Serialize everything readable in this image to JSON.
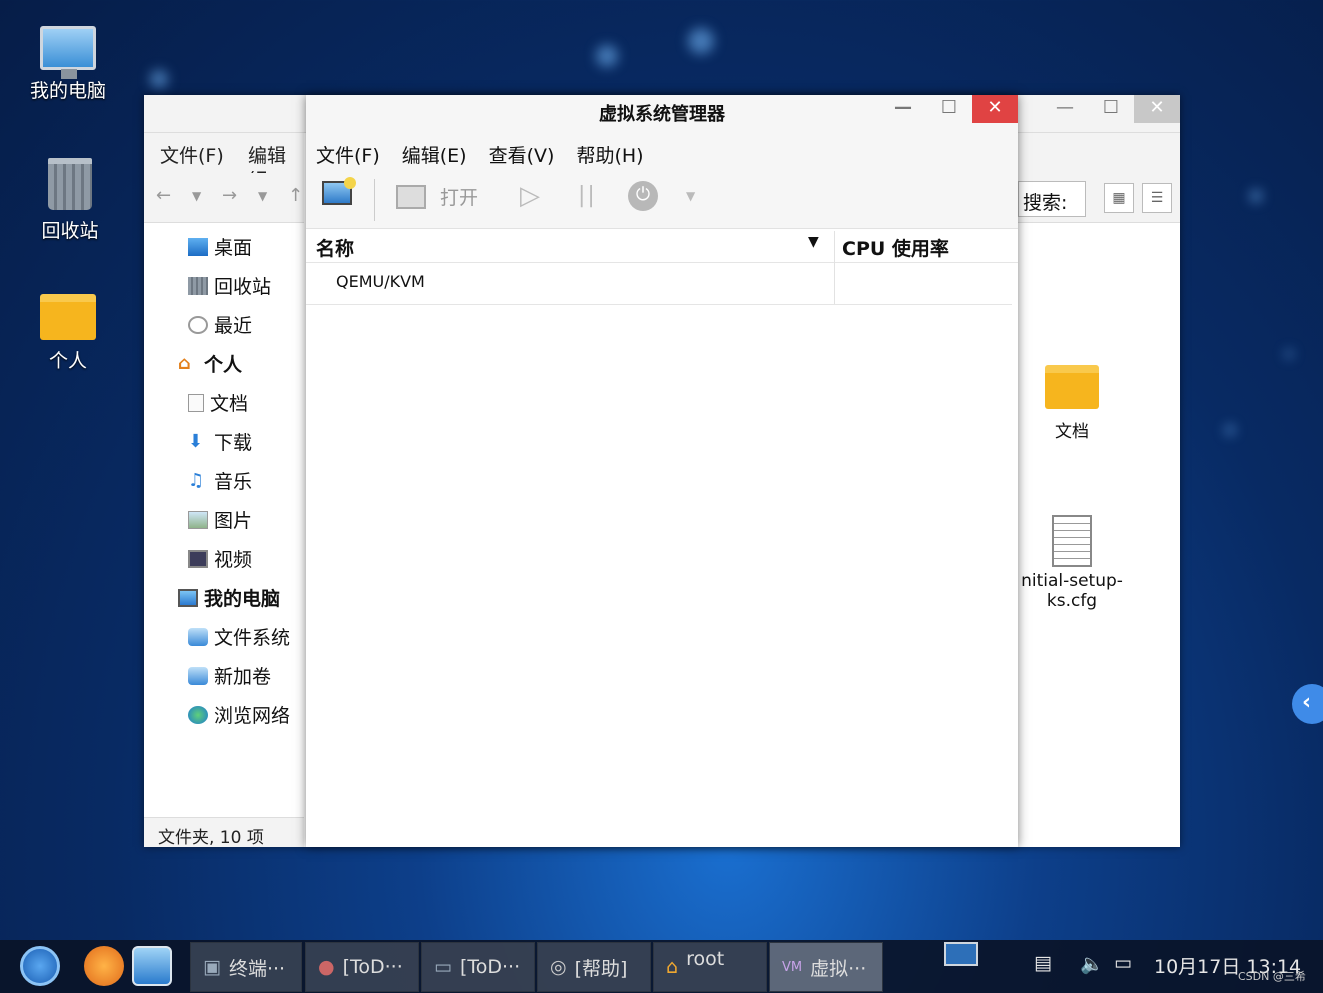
{
  "desktop": {
    "icons": [
      {
        "label": "我的电脑"
      },
      {
        "label": "回收站"
      },
      {
        "label": "个人"
      }
    ]
  },
  "file_manager": {
    "menu": {
      "file": "文件(F)",
      "edit": "编辑(E"
    },
    "sidebar": [
      {
        "label": "桌面"
      },
      {
        "label": "回收站"
      },
      {
        "label": "最近"
      },
      {
        "label": "个人"
      },
      {
        "label": "文档"
      },
      {
        "label": "下载"
      },
      {
        "label": "音乐"
      },
      {
        "label": "图片"
      },
      {
        "label": "视频"
      },
      {
        "label": "我的电脑"
      },
      {
        "label": "文件系统"
      },
      {
        "label": "新加卷"
      },
      {
        "label": "浏览网络"
      }
    ],
    "status": "文件夹, 10 项",
    "search_label": "搜索:",
    "files": [
      {
        "name": "文档"
      },
      {
        "name": "nitial-setup-ks.cfg"
      }
    ]
  },
  "vm_manager": {
    "title": "虚拟系统管理器",
    "menu": [
      "文件(F)",
      "编辑(E)",
      "查看(V)",
      "帮助(H)"
    ],
    "toolbar": {
      "open_label": "打开"
    },
    "columns": {
      "name": "名称",
      "cpu": "CPU 使用率"
    },
    "rows": [
      {
        "name": "QEMU/KVM",
        "cpu": ""
      }
    ]
  },
  "taskbar": {
    "tasks": [
      {
        "label": "终端···"
      },
      {
        "label": "[ToD···"
      },
      {
        "label": "[ToD···"
      },
      {
        "label": "[帮助]"
      },
      {
        "label": "root"
      },
      {
        "label": "虚拟···"
      }
    ],
    "clock": "10月17日 13:14",
    "watermark": "CSDN @三希"
  },
  "colors": {
    "accent": "#3f8be8",
    "close_red": "#e04343",
    "folder": "#f6b51e"
  }
}
